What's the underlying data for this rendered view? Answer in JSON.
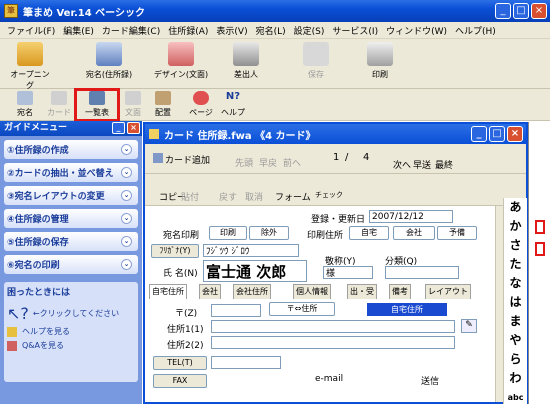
{
  "app": {
    "title": "筆まめ Ver.14 ベーシック"
  },
  "menu": [
    "ファイル(F)",
    "編集(E)",
    "カード編集(C)",
    "住所録(A)",
    "表示(V)",
    "宛名(L)",
    "設定(S)",
    "サービス(I)",
    "ウィンドウ(W)",
    "ヘルプ(H)"
  ],
  "toolbar": {
    "opening": "オープニング",
    "atena": "宛名(住所録)",
    "design": "デザイン(文面)",
    "sashidashi": "差出人",
    "save": "保存",
    "print": "印刷"
  },
  "subtoolbar": {
    "atena": "宛名",
    "card": "カード",
    "ichiran": "一覧表",
    "bunmen": "文面",
    "haichi": "配置",
    "page": "ページ",
    "help": "ヘルプ"
  },
  "guide": {
    "title": "ガイドメニュー",
    "items": [
      "①住所録の作成",
      "②カードの抽出・並べ替え",
      "③宛名レイアウトの変更",
      "④住所録の管理",
      "⑤住所録の保存",
      "⑥宛名の印刷"
    ],
    "help_title": "困ったときには",
    "click_hint": "←クリックしてください",
    "help_link1": "ヘルプを見る",
    "help_link2": "Q&Aを見る"
  },
  "card": {
    "title": "カード 住所録.fwa 《4 カード》",
    "add": "カード追加",
    "first": "先頭",
    "prev_fast": "早戻",
    "prev": "前へ",
    "page_current": "1",
    "sep": "/",
    "page_total": "4",
    "next": "次へ",
    "next_fast": "早送",
    "last": "最終",
    "copy": "コピー",
    "paste": "貼付",
    "undo": "戻す",
    "cancel": "取消",
    "form": "フォーム",
    "check": "チェック",
    "reg_label": "登録・更新日",
    "reg_date": "2007/12/12",
    "atena_print": "宛名印刷",
    "print_btn": "印刷",
    "exclude_btn": "除外",
    "addr_print": "印刷住所",
    "home_btn": "自宅",
    "company_btn": "会社",
    "reserve_btn": "予備",
    "furigana_label": "ﾌﾘｶﾞﾅ(Y)",
    "furigana": "ﾌｼﾞﾂｳ ｼﾞﾛｳ",
    "name_label": "氏 名(N)",
    "name": "富士通 次郎",
    "honorific_label": "敬称(Y)",
    "honorific": "様",
    "category_label": "分類(Q)",
    "tabs": [
      "自宅住所",
      "会社",
      "会社住所",
      "個人情報",
      "出・受",
      "備考",
      "レイアウト"
    ],
    "zip_label": "〒(Z)",
    "zip_btn": "〒⇔住所",
    "home_addr_badge": "自宅住所",
    "addr1_label": "住所1(1)",
    "addr2_label": "住所2(2)",
    "tel_label": "TEL(T)",
    "fax_label": "FAX",
    "email_label": "e-mail",
    "send_label": "送信"
  },
  "kana": [
    "あ",
    "か",
    "さ",
    "た",
    "な",
    "は",
    "ま",
    "や",
    "ら",
    "わ",
    "abc"
  ]
}
